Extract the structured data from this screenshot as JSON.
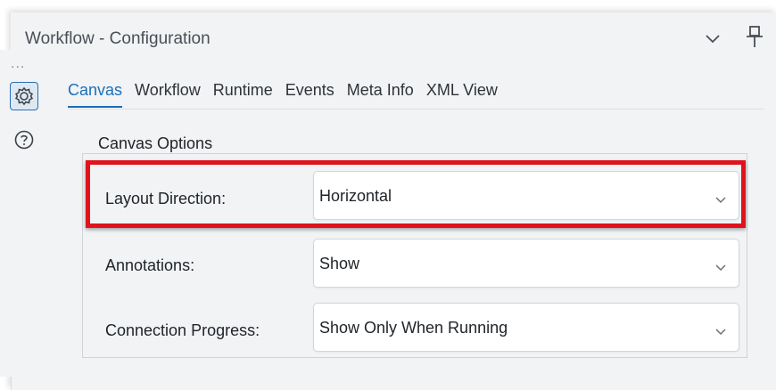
{
  "window": {
    "title": "Workflow - Configuration"
  },
  "side_panel": {
    "dots": "...",
    "icons": [
      "gear-icon",
      "help-icon"
    ]
  },
  "tabs": [
    {
      "label": "Canvas",
      "active": true
    },
    {
      "label": "Workflow",
      "active": false
    },
    {
      "label": "Runtime",
      "active": false
    },
    {
      "label": "Events",
      "active": false
    },
    {
      "label": "Meta Info",
      "active": false
    },
    {
      "label": "XML View",
      "active": false
    }
  ],
  "canvas_options": {
    "legend": "Canvas Options",
    "layout_direction": {
      "label": "Layout Direction:",
      "value": "Horizontal"
    },
    "annotations": {
      "label": "Annotations:",
      "value": "Show"
    },
    "connection_progress": {
      "label": "Connection Progress:",
      "value": "Show Only When Running"
    }
  },
  "colors": {
    "accent": "#1b6fb8",
    "highlight": "#e0121b",
    "background": "#f1f3f5"
  }
}
